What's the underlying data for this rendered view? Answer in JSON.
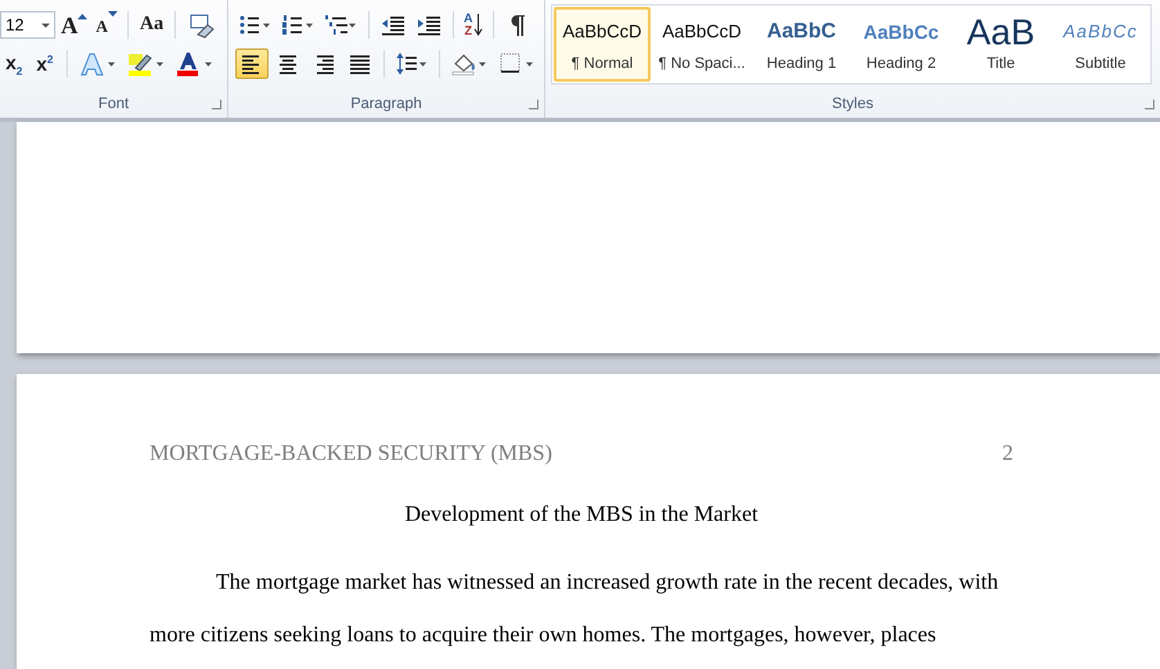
{
  "font_group": {
    "label": "Font",
    "size": "12",
    "grow_font": "A",
    "shrink_font": "A",
    "change_case": "Aa",
    "subscript": "x$_{2}$",
    "superscript": "x$^{2}$"
  },
  "sort": {
    "top": "A",
    "bottom": "Z"
  },
  "paragraph_group": {
    "label": "Paragraph",
    "alignments": [
      {
        "kind": "left",
        "selected": true
      },
      {
        "kind": "center",
        "selected": false
      },
      {
        "kind": "right",
        "selected": false
      },
      {
        "kind": "justify",
        "selected": false
      }
    ]
  },
  "styles_group": {
    "label": "Styles",
    "styles": [
      {
        "kind": "normal",
        "preview": "AaBbCcD",
        "name": "¶ Normal",
        "selected": true
      },
      {
        "kind": "normal",
        "preview": "AaBbCcD",
        "name": "¶ No Spaci...",
        "selected": false
      },
      {
        "kind": "heading1",
        "preview": "AaBbC",
        "name": "Heading 1",
        "selected": false
      },
      {
        "kind": "heading2",
        "preview": "AaBbCc",
        "name": "Heading 2",
        "selected": false
      },
      {
        "kind": "title",
        "preview": "AaB",
        "name": "Title",
        "selected": false
      },
      {
        "kind": "subtitle",
        "preview": "AaBbCc",
        "name": "Subtitle",
        "selected": false
      }
    ]
  },
  "document": {
    "header": "MORTGAGE-BACKED SECURITY (MBS)",
    "page_number": "2",
    "title": "Development of the MBS in the Market",
    "paragraph": "The mortgage market has witnessed an increased growth rate in the recent decades, with more citizens seeking loans to acquire their own homes. The mortgages, however, places"
  }
}
